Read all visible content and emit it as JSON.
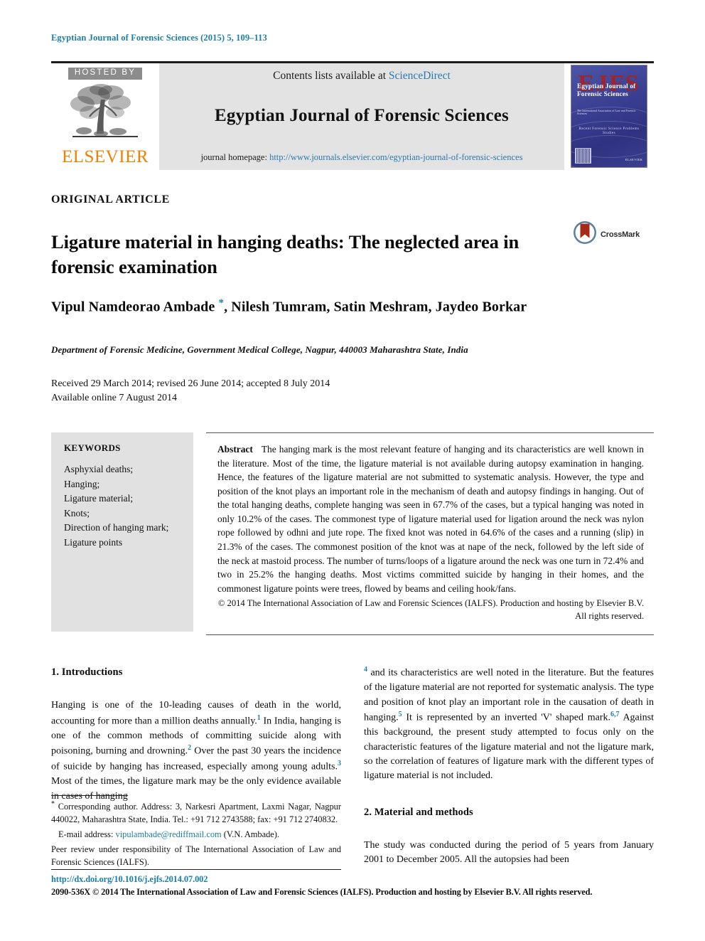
{
  "running_head": "Egyptian Journal of Forensic Sciences (2015) 5, 109–113",
  "masthead": {
    "hosted_by": "HOSTED BY",
    "publisher": "ELSEVIER",
    "contents_prefix": "Contents lists available at",
    "contents_link": "ScienceDirect",
    "journal_title": "Egyptian Journal of Forensic Sciences",
    "homepage_prefix": "journal homepage:",
    "homepage_url": "http://www.journals.elsevier.com/egyptian-journal-of-forensic-sciences",
    "cover": {
      "acronym": "EJFS",
      "title": "Egyptian Journal of Forensic Sciences",
      "subtitle": "The International Association of Law and Forensic Sciences",
      "band": "Recent Forensic Science Problems Studies",
      "publisher": "ELSEVIER"
    }
  },
  "article": {
    "type": "ORIGINAL ARTICLE",
    "title": "Ligature material in hanging deaths: The neglected area in forensic examination",
    "crossmark_label": "CrossMark",
    "authors": "Vipul Namdeorao Ambade ",
    "authors_rest": ", Nilesh Tumram, Satin Meshram, Jaydeo Borkar",
    "corresponding_marker": "*",
    "affiliation": "Department of Forensic Medicine, Government Medical College, Nagpur, 440003 Maharashtra State, India",
    "dates_line1": "Received 29 March 2014; revised 26 June 2014; accepted 8 July 2014",
    "dates_line2": "Available online 7 August 2014"
  },
  "keywords": {
    "heading": "KEYWORDS",
    "items": "Asphyxial deaths;\nHanging;\nLigature material;\nKnots;\nDirection of hanging mark;\nLigature points"
  },
  "abstract": {
    "label": "Abstract",
    "text": "The hanging mark is the most relevant feature of hanging and its characteristics are well known in the literature. Most of the time, the ligature material is not available during autopsy examination in hanging. Hence, the features of the ligature material are not submitted to systematic analysis. However, the type and position of the knot plays an important role in the mechanism of death and autopsy findings in hanging. Out of the total hanging deaths, complete hanging was seen in 67.7% of the cases, but a typical hanging was noted in only 10.2% of the cases. The commonest type of ligature material used for ligation around the neck was nylon rope followed by odhni and jute rope. The fixed knot was noted in 64.6% of the cases and a running (slip) in 21.3% of the cases. The commonest position of the knot was at nape of the neck, followed by the left side of the neck at mastoid process. The number of turns/loops of a ligature around the neck was one turn in 72.4% and two in 25.2% the hanging deaths. Most victims committed suicide by hanging in their homes, and the commonest ligature points were trees, flowed by beams and ceiling hook/fans.",
    "copyright": "© 2014 The International Association of Law and Forensic Sciences (IALFS). Production and hosting by Elsevier B.V. All rights reserved."
  },
  "body": {
    "section1_heading": "1. Introductions",
    "section1_p1_a": "Hanging is one of the 10-leading causes of death in the world, accounting for more than a million deaths annually.",
    "section1_p1_ref1": "1",
    "section1_p1_b": " In India, hanging is one of the common methods of committing suicide along with poisoning, burning and drowning.",
    "section1_p1_ref2": "2",
    "section1_p1_c": " Over the past 30 years the incidence of suicide by hanging has increased, especially among young adults.",
    "section1_p1_ref3": "3",
    "section1_p1_d": " Most of the times, the ligature mark may be the only evidence available in cases of hanging",
    "section1_p1_ref4": "4",
    "section1_p1_e": " and its characteristics are well noted in the literature. But the features of the ligature material are not reported for systematic analysis. The type and position of knot play an important role in the causation of death in hanging.",
    "section1_p1_ref5": "5",
    "section1_p1_f": " It is represented by an inverted 'V' shaped mark.",
    "section1_p1_ref67": "6,7",
    "section1_p1_g": " Against this background, the present study attempted to focus only on the characteristic features of the ligature material and not the ligature mark, so the correlation of features of ligature mark with the different types of ligature material is not included.",
    "section2_heading": "2. Material and methods",
    "section2_p1": "The study was conducted during the period of 5 years from January 2001 to December 2005. All the autopsies had been"
  },
  "footnote": {
    "corresponding": "Corresponding author. Address: 3, Narkesri Apartment, Laxmi Nagar, Nagpur 440022, Maharashtra State, India. Tel.: +91 712 2743588; fax: +91 712 2740832.",
    "email_label": "E-mail address:",
    "email": "vipulambade@rediffmail.com",
    "email_suffix": "(V.N. Ambade).",
    "peer_review": "Peer review under responsibility of The International Association of Law and Forensic Sciences (IALFS)."
  },
  "footer": {
    "doi": "http://dx.doi.org/10.1016/j.ejfs.2014.07.002",
    "copyright": "2090-536X © 2014 The International Association of Law and Forensic Sciences (IALFS). Production and hosting by Elsevier B.V. All rights reserved."
  },
  "colors": {
    "link": "#1a7fa8",
    "elsevier_orange": "#f08000",
    "crossmark_red": "#a52a1a",
    "keyword_bg": "#e1e1e1",
    "masthead_bg": "#e3e3e3"
  }
}
